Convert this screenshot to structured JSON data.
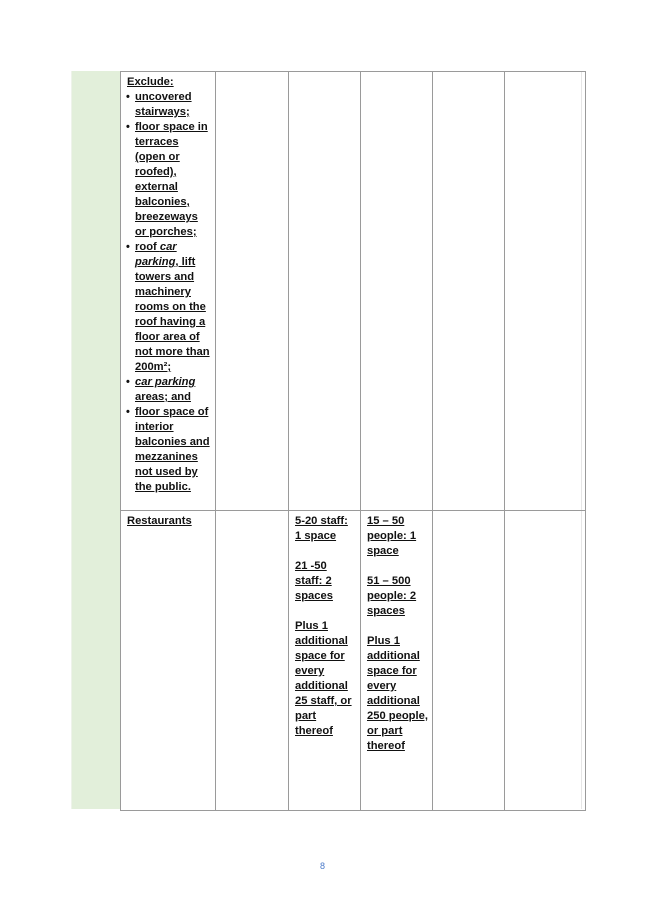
{
  "table": {
    "row_exclusions": {
      "heading": "Exclude:",
      "items": [
        {
          "parts": [
            {
              "text": "uncovered stairways;",
              "italic": false
            }
          ]
        },
        {
          "parts": [
            {
              "text": "floor space in terraces (open or roofed), external balconies, breezeways or porches;",
              "italic": false
            }
          ]
        },
        {
          "parts": [
            {
              "text": "roof ",
              "italic": false
            },
            {
              "text": "car parking",
              "italic": true
            },
            {
              "text": ", lift towers and machinery rooms on the roof having a floor area of not more than 200m²;",
              "italic": false
            }
          ]
        },
        {
          "parts": [
            {
              "text": "car parking",
              "italic": true
            },
            {
              "text": " areas; and",
              "italic": false
            }
          ]
        },
        {
          "parts": [
            {
              "text": "floor space of interior balconies and mezzanines not used by the public.",
              "italic": false
            }
          ]
        }
      ]
    },
    "row_restaurants": {
      "label": "Restaurants",
      "staff_rules": [
        "5-20 staff: 1 space",
        "21 -50 staff: 2 spaces",
        "Plus 1 additional space for every additional 25 staff, or part thereof"
      ],
      "people_rules": [
        "15 – 50 people: 1 space",
        "51 – 500 people: 2 spaces",
        "Plus 1 additional space for every additional 250 people, or part thereof"
      ]
    }
  },
  "page_number": "8"
}
